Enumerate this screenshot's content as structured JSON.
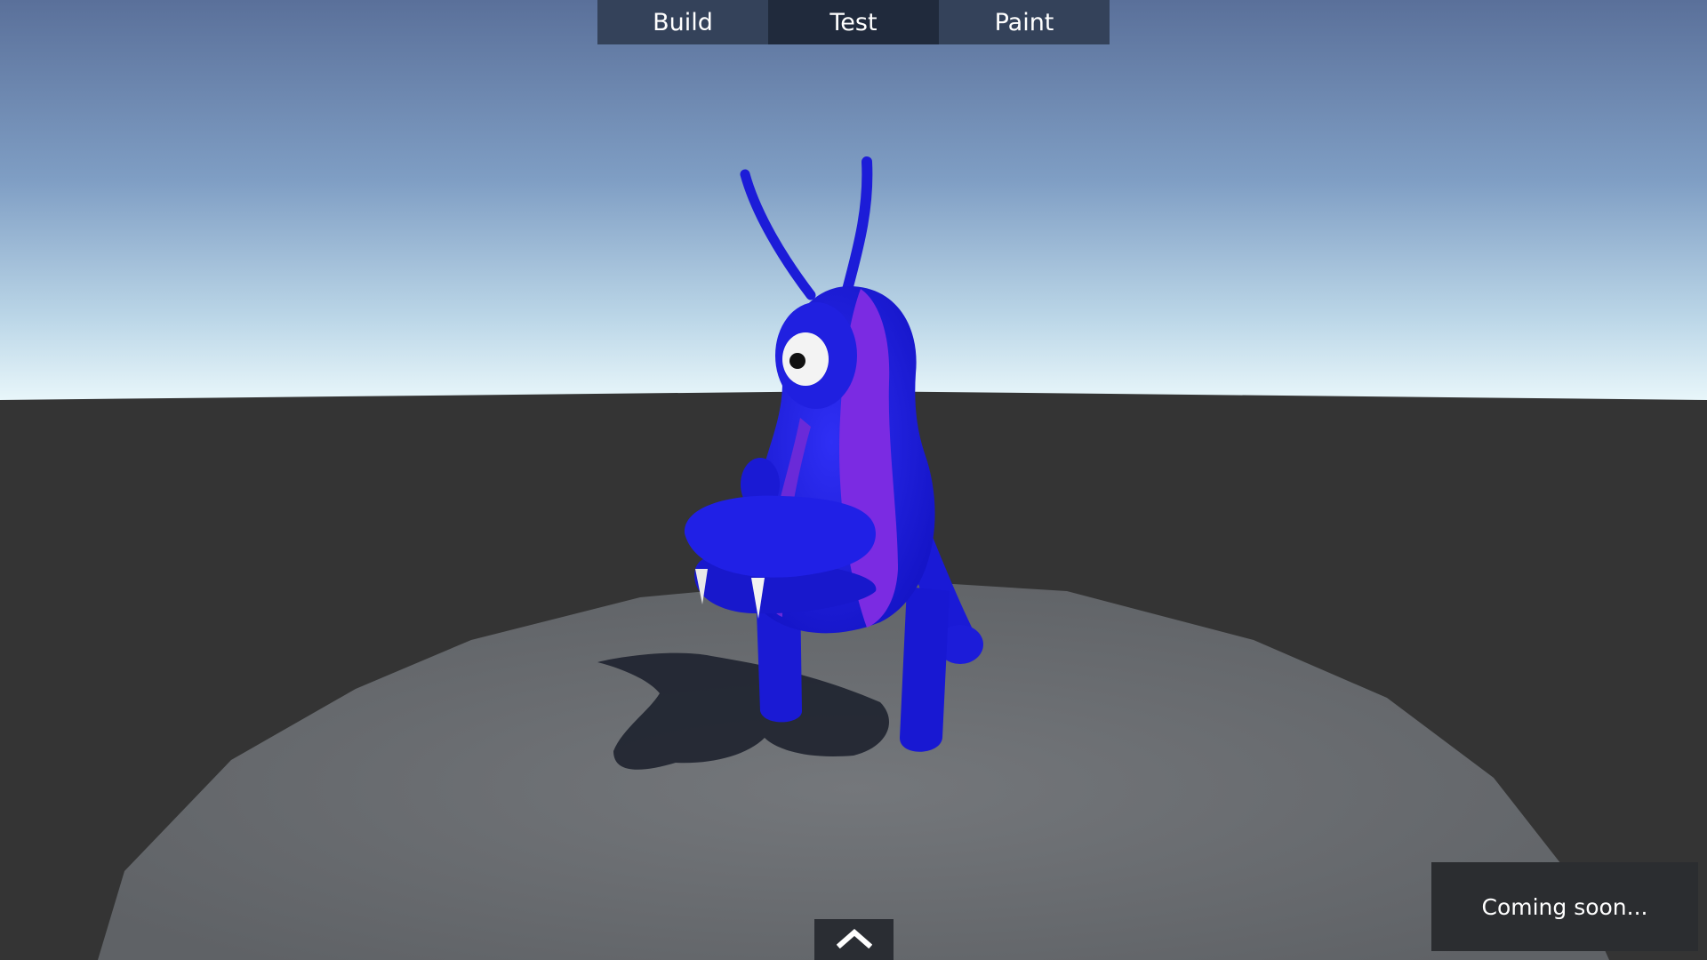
{
  "tabs": [
    {
      "label": "Build",
      "active": false
    },
    {
      "label": "Test",
      "active": true
    },
    {
      "label": "Paint",
      "active": false
    }
  ],
  "bottom_toggle": {
    "icon": "chevron-up-icon"
  },
  "status_panel": {
    "text": "Coming soon..."
  },
  "scene": {
    "subject": "blue-creature",
    "colors": {
      "creature_primary": "#1f1fe6",
      "creature_stripe": "#7a2be0",
      "sky_top": "#5b7299",
      "sky_horizon": "#e6f5fa",
      "ground": "#343434",
      "platform": "#6e7175"
    }
  }
}
